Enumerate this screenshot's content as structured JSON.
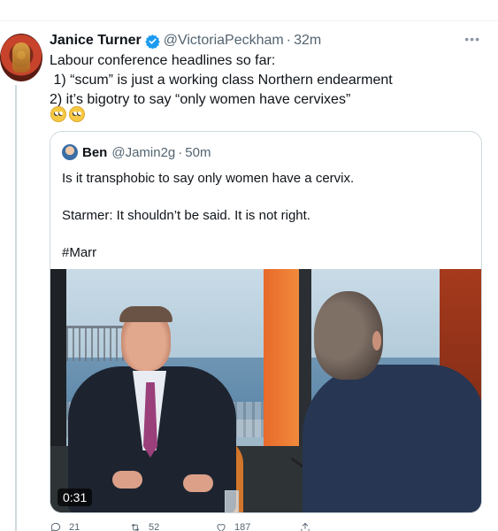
{
  "tweet": {
    "author_name": "Janice Turner",
    "author_handle": "@VictoriaPeckham",
    "separator": "·",
    "timestamp": "32m",
    "text": "Labour conference headlines so far:\n 1) “scum” is just a working class Northern endearment\n2) it’s bigotry to say “only women have cervixes”",
    "emojis": [
      "face-with-rolling-eyes",
      "face-with-rolling-eyes"
    ],
    "verified": true
  },
  "quote": {
    "author_name": "Ben",
    "author_handle": "@Jamin2g",
    "separator": "·",
    "timestamp": "50m",
    "paragraphs": [
      "Is it transphobic to say only women have a cervix.",
      "Starmer: It shouldn’t be said. It is not right.",
      "#Marr"
    ],
    "video_duration": "0:31"
  },
  "actions": {
    "replies": "21",
    "retweets": "52",
    "likes": "187"
  },
  "colors": {
    "verified_blue": "#1d9bf0",
    "secondary_text": "#536471",
    "border": "#cfd9de"
  }
}
